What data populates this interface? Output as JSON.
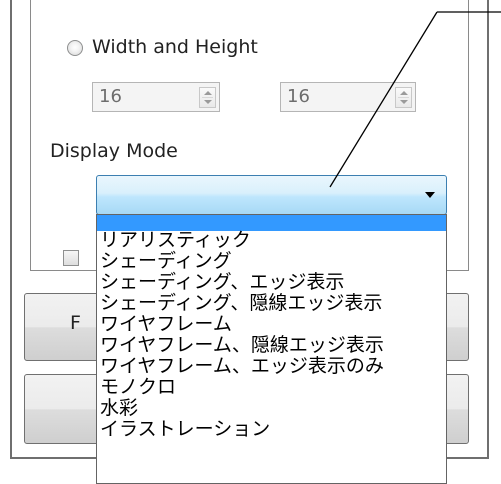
{
  "size_mode": {
    "radio_label": "Width and Height",
    "width_value": "16",
    "height_value": "16"
  },
  "display_mode": {
    "label": "Display Mode",
    "selected": ""
  },
  "dropdown": {
    "options": [
      "リアリスティック",
      "シェーディング",
      "シェーディング、エッジ表示",
      "シェーディング、隠線エッジ表示",
      "ワイヤフレーム",
      "ワイヤフレーム、隠線エッジ表示",
      "ワイヤフレーム、エッジ表示のみ",
      "モノクロ",
      "水彩",
      "イラストレーション"
    ]
  },
  "background": {
    "button_fragment": "F"
  },
  "colors": {
    "highlight": "#3399ff",
    "combo_border": "#3c7fb1"
  }
}
